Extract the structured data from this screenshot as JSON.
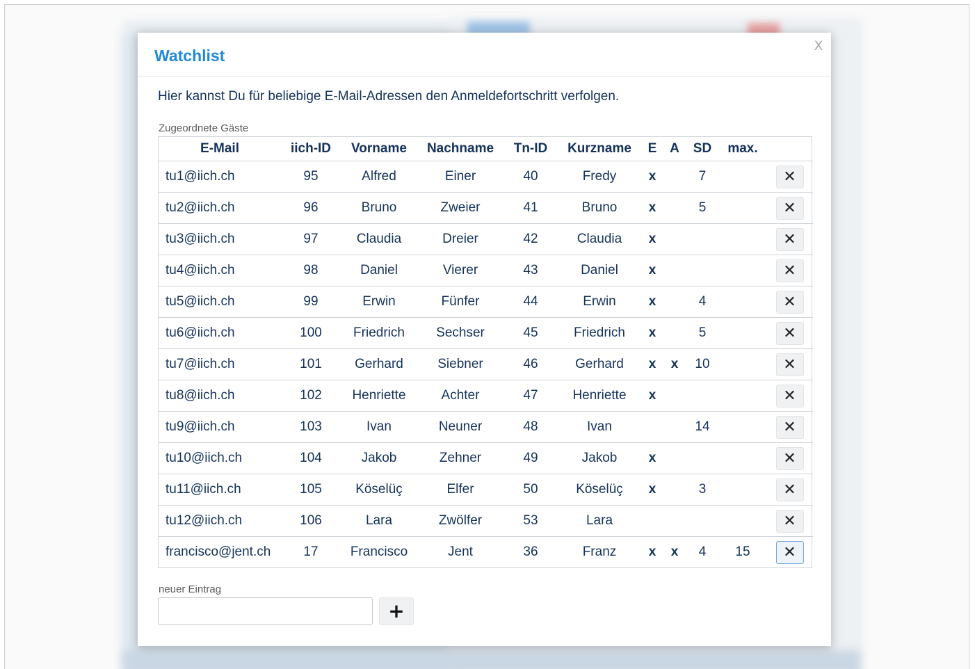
{
  "dialog": {
    "title": "Watchlist",
    "close_label": "X",
    "intro": "Hier kannst Du für beliebige E-Mail-Adressen den Anmeldefortschritt verfolgen.",
    "assigned_label": "Zugeordnete Gäste",
    "new_entry_label": "neuer Eintrag",
    "new_entry_value": "",
    "add_label": "+",
    "delete_label": "✕"
  },
  "table": {
    "headers": [
      "E-Mail",
      "iich-ID",
      "Vorname",
      "Nachname",
      "Tn-ID",
      "Kurzname",
      "E",
      "A",
      "SD",
      "max.",
      ""
    ],
    "rows": [
      {
        "email": "tu1@iich.ch",
        "iich_id": "95",
        "vorname": "Alfred",
        "nachname": "Einer",
        "tn_id": "40",
        "kurzname": "Fredy",
        "e": "x",
        "a": "",
        "sd": "7",
        "max": ""
      },
      {
        "email": "tu2@iich.ch",
        "iich_id": "96",
        "vorname": "Bruno",
        "nachname": "Zweier",
        "tn_id": "41",
        "kurzname": "Bruno",
        "e": "x",
        "a": "",
        "sd": "5",
        "max": ""
      },
      {
        "email": "tu3@iich.ch",
        "iich_id": "97",
        "vorname": "Claudia",
        "nachname": "Dreier",
        "tn_id": "42",
        "kurzname": "Claudia",
        "e": "x",
        "a": "",
        "sd": "",
        "max": ""
      },
      {
        "email": "tu4@iich.ch",
        "iich_id": "98",
        "vorname": "Daniel",
        "nachname": "Vierer",
        "tn_id": "43",
        "kurzname": "Daniel",
        "e": "x",
        "a": "",
        "sd": "",
        "max": ""
      },
      {
        "email": "tu5@iich.ch",
        "iich_id": "99",
        "vorname": "Erwin",
        "nachname": "Fünfer",
        "tn_id": "44",
        "kurzname": "Erwin",
        "e": "x",
        "a": "",
        "sd": "4",
        "max": ""
      },
      {
        "email": "tu6@iich.ch",
        "iich_id": "100",
        "vorname": "Friedrich",
        "nachname": "Sechser",
        "tn_id": "45",
        "kurzname": "Friedrich",
        "e": "x",
        "a": "",
        "sd": "5",
        "max": ""
      },
      {
        "email": "tu7@iich.ch",
        "iich_id": "101",
        "vorname": "Gerhard",
        "nachname": "Siebner",
        "tn_id": "46",
        "kurzname": "Gerhard",
        "e": "x",
        "a": "x",
        "sd": "10",
        "max": ""
      },
      {
        "email": "tu8@iich.ch",
        "iich_id": "102",
        "vorname": "Henriette",
        "nachname": "Achter",
        "tn_id": "47",
        "kurzname": "Henriette",
        "e": "x",
        "a": "",
        "sd": "",
        "max": ""
      },
      {
        "email": "tu9@iich.ch",
        "iich_id": "103",
        "vorname": "Ivan",
        "nachname": "Neuner",
        "tn_id": "48",
        "kurzname": "Ivan",
        "e": "",
        "a": "",
        "sd": "14",
        "max": ""
      },
      {
        "email": "tu10@iich.ch",
        "iich_id": "104",
        "vorname": "Jakob",
        "nachname": "Zehner",
        "tn_id": "49",
        "kurzname": "Jakob",
        "e": "x",
        "a": "",
        "sd": "",
        "max": ""
      },
      {
        "email": "tu11@iich.ch",
        "iich_id": "105",
        "vorname": "Köselüç",
        "nachname": "Elfer",
        "tn_id": "50",
        "kurzname": "Köselüç",
        "e": "x",
        "a": "",
        "sd": "3",
        "max": ""
      },
      {
        "email": "tu12@iich.ch",
        "iich_id": "106",
        "vorname": "Lara",
        "nachname": "Zwölfer",
        "tn_id": "53",
        "kurzname": "Lara",
        "e": "",
        "a": "",
        "sd": "",
        "max": ""
      },
      {
        "email": "francisco@jent.ch",
        "iich_id": "17",
        "vorname": "Francisco",
        "nachname": "Jent",
        "tn_id": "36",
        "kurzname": "Franz",
        "e": "x",
        "a": "x",
        "sd": "4",
        "max": "15"
      }
    ]
  },
  "colors": {
    "title": "#1f8ad6",
    "text": "#15325a"
  }
}
